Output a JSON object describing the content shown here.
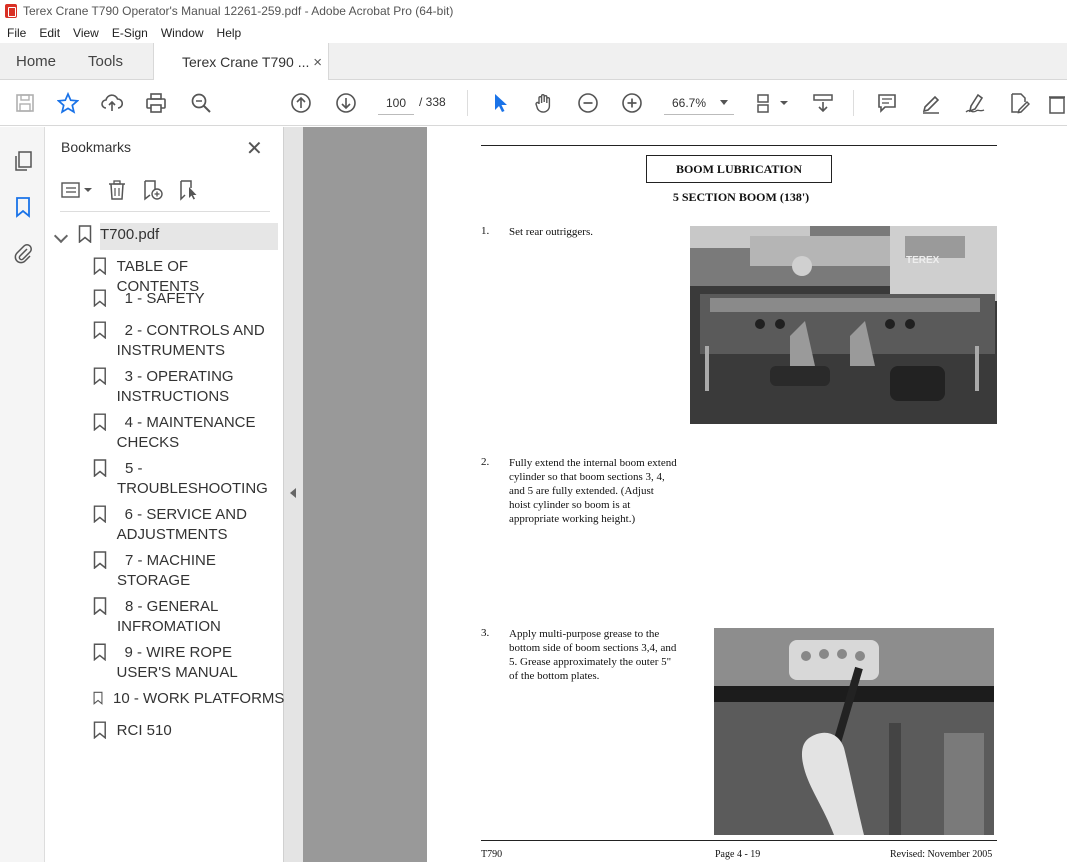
{
  "window": {
    "title": "Terex Crane T790 Operator's Manual 12261-259.pdf - Adobe Acrobat Pro (64-bit)"
  },
  "menu": [
    "File",
    "Edit",
    "View",
    "E-Sign",
    "Window",
    "Help"
  ],
  "tabs": {
    "home": "Home",
    "tools": "Tools",
    "document": "Terex Crane T790 ...",
    "close": "×"
  },
  "toolbar": {
    "current_page": "100",
    "total_pages": "/ 338",
    "zoom": "66.7%"
  },
  "bookmarks": {
    "title": "Bookmarks",
    "close": "✕",
    "root": "T700.pdf",
    "items": [
      {
        "label": "TABLE OF CONTENTS"
      },
      {
        "label": "1 - SAFETY"
      },
      {
        "label": "2 - CONTROLS AND INSTRUMENTS"
      },
      {
        "label": "3 - OPERATING INSTRUCTIONS"
      },
      {
        "label": "4 - MAINTENANCE CHECKS"
      },
      {
        "label": "5 - TROUBLESHOOTING"
      },
      {
        "label": "6 - SERVICE AND ADJUSTMENTS"
      },
      {
        "label": "7 - MACHINE STORAGE"
      },
      {
        "label": "8 - GENERAL INFROMATION"
      },
      {
        "label": "9 - WIRE ROPE USER'S MANUAL"
      },
      {
        "label": "10 - WORK PLATFORMS"
      },
      {
        "label": "RCI 510"
      }
    ]
  },
  "document": {
    "heading": "BOOM LUBRICATION",
    "subheading": "5 SECTION BOOM (138')",
    "steps": [
      {
        "num": "1.",
        "text": "Set rear outriggers."
      },
      {
        "num": "2.",
        "text": "Fully extend the internal boom extend cylinder so that boom sections 3, 4, and 5 are fully extended. (Adjust hoist cylinder so boom is at appropriate working height.)"
      },
      {
        "num": "3.",
        "text": "Apply multi-purpose grease to the bottom side of boom sections 3,4, and 5. Grease approximately the outer 5\" of the bottom plates."
      }
    ],
    "photo_text": "TEREX",
    "footer": {
      "left": "T790",
      "center": "Page 4 - 19",
      "right": "Revised: November 2005"
    }
  }
}
